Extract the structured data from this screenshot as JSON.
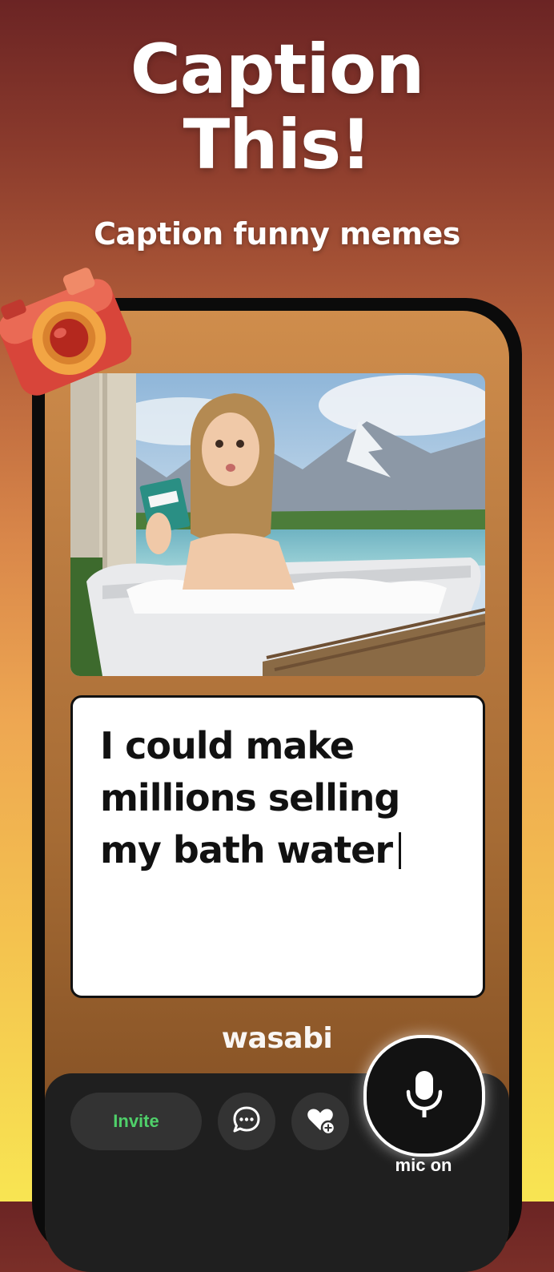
{
  "header": {
    "title_line1": "Caption",
    "title_line2": "This!",
    "subtitle": "Caption funny memes"
  },
  "game": {
    "caption_text": "I could make millions selling my bath water",
    "brand": "wasabi"
  },
  "toolbar": {
    "invite_label": "Invite",
    "mic_label": "mic on"
  },
  "icons": {
    "camera": "camera-icon",
    "chat": "chat-icon",
    "heart": "heart-plus-icon",
    "mic": "microphone-icon"
  },
  "colors": {
    "invite_text": "#4fd06a",
    "toolbar_bg": "#1f1f1f"
  }
}
